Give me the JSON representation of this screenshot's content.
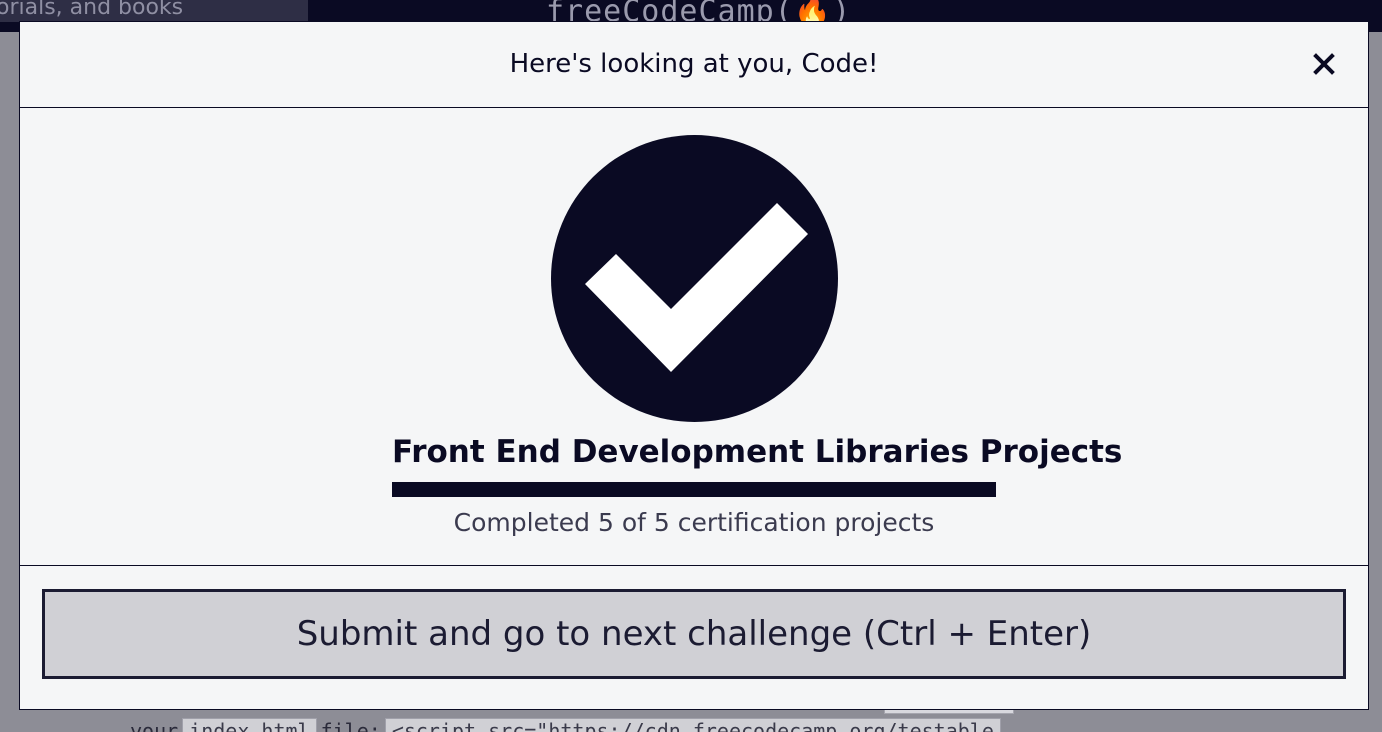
{
  "background": {
    "search_text": "orials, and books",
    "brand": "freeCodeCamp(🔥)",
    "code_prefix": "your",
    "code_chip1": "index.html",
    "code_word": "file:",
    "code_chip2": "<script src=\"https://cdn.freecodecamp.org/testable"
  },
  "modal": {
    "title": "Here's looking at you, Code!",
    "close_label": "Close",
    "project_title": "Front End Development Libraries Projects",
    "progress": {
      "completed": 5,
      "total": 5,
      "percent": 100
    },
    "progress_text": "Completed 5 of 5 certification projects",
    "submit_label": "Submit and go to next challenge (Ctrl + Enter)"
  },
  "colors": {
    "dark": "#0a0a23",
    "button_bg": "#d0d0d5",
    "modal_bg": "#f5f6f7"
  },
  "icons": [
    "close-icon",
    "checkmark-circle-icon"
  ]
}
